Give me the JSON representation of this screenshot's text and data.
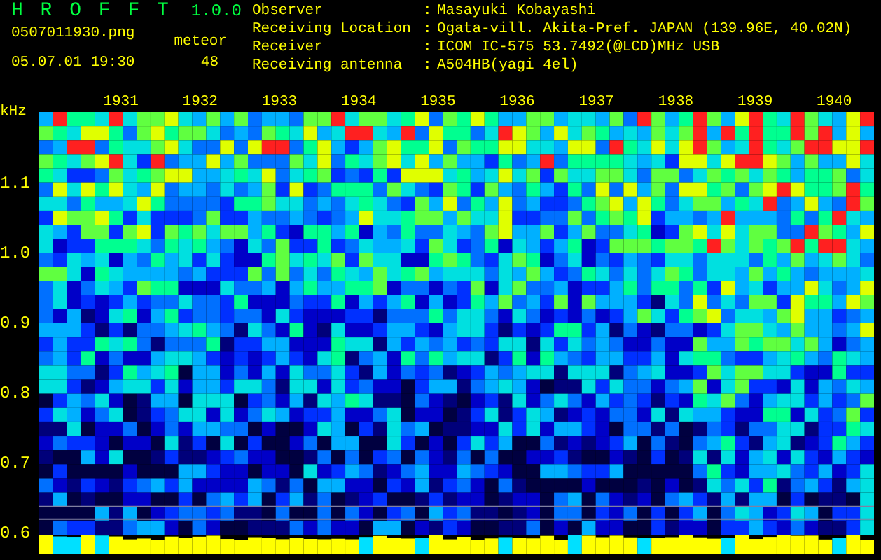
{
  "header": {
    "title": "H R O F F T",
    "version": "1.0.0",
    "file": "0507011930.png",
    "datetime": "05.07.01 19:30",
    "meteor_label": "meteor",
    "meteor_count": "48"
  },
  "info": [
    {
      "label": "Observer",
      "separator": ":",
      "value": "Masayuki Kobayashi"
    },
    {
      "label": "Receiving Location",
      "separator": ":",
      "value": "Ogata-vill. Akita-Pref. JAPAN (139.96E, 40.02N)"
    },
    {
      "label": "Receiver",
      "separator": ":",
      "value": "ICOM IC-575 53.7492(@LCD)MHz USB"
    },
    {
      "label": "Receiving antenna",
      "separator": ":",
      "value": "A504HB(yagi 4el)"
    }
  ],
  "spectrogram": {
    "unit": "kHz",
    "yticks": [
      "1.1",
      "1.0",
      "0.9",
      "0.8",
      "0.7",
      "0.6"
    ],
    "minutes": [
      "1931",
      "1932",
      "1933",
      "1934",
      "1935",
      "1936",
      "1937",
      "1938",
      "1939",
      "1940"
    ]
  }
}
